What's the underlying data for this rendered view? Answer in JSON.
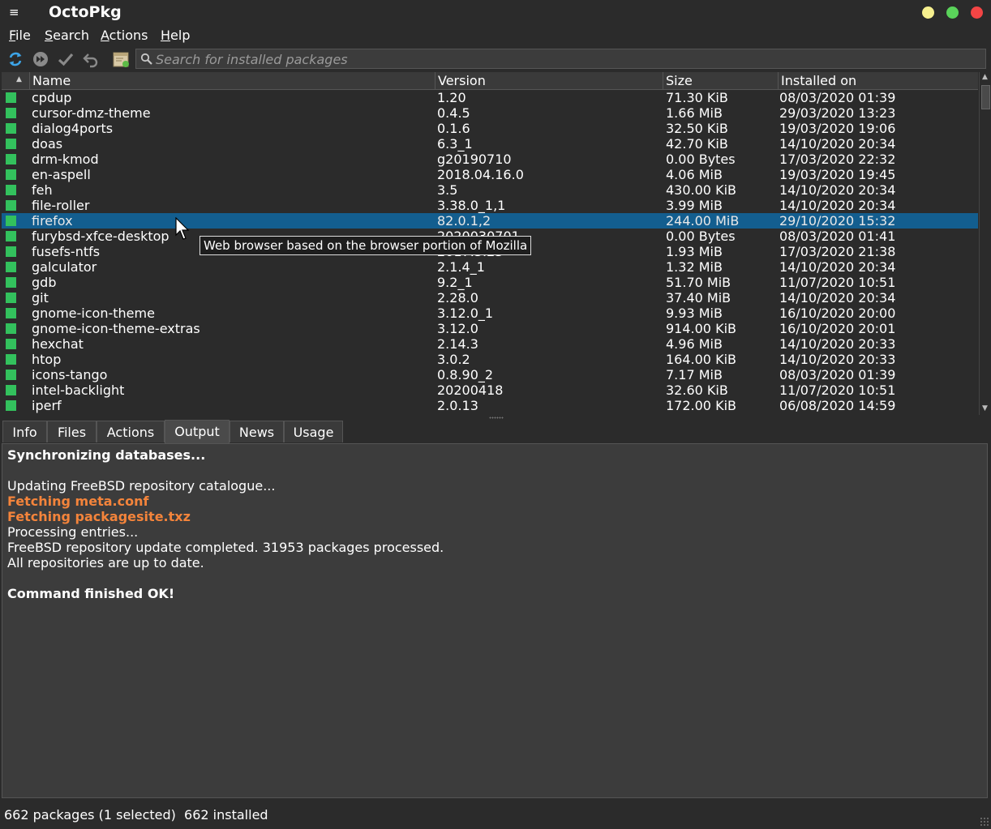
{
  "window": {
    "title": "OctoPkg",
    "menu_glyph": "≡",
    "buttons": {
      "minimize_color": "#f7f08f",
      "maximize_color": "#5ad35a",
      "close_color": "#f34545"
    }
  },
  "menubar": {
    "items": [
      {
        "first": "F",
        "rest": "ile"
      },
      {
        "first": "S",
        "rest": "earch"
      },
      {
        "first": "A",
        "rest": "ctions"
      },
      {
        "first": "H",
        "rest": "elp"
      }
    ]
  },
  "toolbar": {
    "icons": [
      "sync-database-icon",
      "run-transaction-icon",
      "commit-icon",
      "undo-icon",
      "system-upgrade-icon"
    ],
    "search_placeholder": "Search for installed packages",
    "search_value": ""
  },
  "table": {
    "columns": [
      "Name",
      "Version",
      "Size",
      "Installed on"
    ],
    "rows": [
      {
        "name": "cpdup",
        "version": "1.20",
        "size": "71.30 KiB",
        "installed": "08/03/2020 01:39"
      },
      {
        "name": "cursor-dmz-theme",
        "version": "0.4.5",
        "size": "1.66 MiB",
        "installed": "29/03/2020 13:23"
      },
      {
        "name": "dialog4ports",
        "version": "0.1.6",
        "size": "32.50 KiB",
        "installed": "19/03/2020 19:06"
      },
      {
        "name": "doas",
        "version": "6.3_1",
        "size": "42.70 KiB",
        "installed": "14/10/2020 20:34"
      },
      {
        "name": "drm-kmod",
        "version": "g20190710",
        "size": "0.00 Bytes",
        "installed": "17/03/2020 22:32"
      },
      {
        "name": "en-aspell",
        "version": "2018.04.16.0",
        "size": "4.06 MiB",
        "installed": "19/03/2020 19:45"
      },
      {
        "name": "feh",
        "version": "3.5",
        "size": "430.00 KiB",
        "installed": "14/10/2020 20:34"
      },
      {
        "name": "file-roller",
        "version": "3.38.0_1,1",
        "size": "3.99 MiB",
        "installed": "14/10/2020 20:34"
      },
      {
        "name": "firefox",
        "version": "82.0.1,2",
        "size": "244.00 MiB",
        "installed": "29/10/2020 15:32",
        "selected": true
      },
      {
        "name": "furybsd-xfce-desktop",
        "version": "2020030701",
        "size": "0.00 Bytes",
        "installed": "08/03/2020 01:41"
      },
      {
        "name": "fusefs-ntfs",
        "version": "2017.3.23",
        "size": "1.93 MiB",
        "installed": "17/03/2020 21:38"
      },
      {
        "name": "galculator",
        "version": "2.1.4_1",
        "size": "1.32 MiB",
        "installed": "14/10/2020 20:34"
      },
      {
        "name": "gdb",
        "version": "9.2_1",
        "size": "51.70 MiB",
        "installed": "11/07/2020 10:51"
      },
      {
        "name": "git",
        "version": "2.28.0",
        "size": "37.40 MiB",
        "installed": "14/10/2020 20:34"
      },
      {
        "name": "gnome-icon-theme",
        "version": "3.12.0_1",
        "size": "9.93 MiB",
        "installed": "16/10/2020 20:00"
      },
      {
        "name": "gnome-icon-theme-extras",
        "version": "3.12.0",
        "size": "914.00 KiB",
        "installed": "16/10/2020 20:01"
      },
      {
        "name": "hexchat",
        "version": "2.14.3",
        "size": "4.96 MiB",
        "installed": "14/10/2020 20:33"
      },
      {
        "name": "htop",
        "version": "3.0.2",
        "size": "164.00 KiB",
        "installed": "14/10/2020 20:33"
      },
      {
        "name": "icons-tango",
        "version": "0.8.90_2",
        "size": "7.17 MiB",
        "installed": "08/03/2020 01:39"
      },
      {
        "name": "intel-backlight",
        "version": "20200418",
        "size": "32.60 KiB",
        "installed": "11/07/2020 10:51"
      },
      {
        "name": "iperf",
        "version": "2.0.13",
        "size": "172.00 KiB",
        "installed": "06/08/2020 14:59"
      }
    ],
    "status_color": "#33c15d",
    "selection_color": "#135e8f"
  },
  "tooltip": "Web browser based on the browser portion of Mozilla",
  "tabs": [
    {
      "label": "Info"
    },
    {
      "label": "Files"
    },
    {
      "label": "Actions"
    },
    {
      "label": "Output",
      "active": true
    },
    {
      "label": "News"
    },
    {
      "label": "Usage"
    }
  ],
  "output": [
    {
      "text": "Synchronizing databases...",
      "style": "bold"
    },
    {
      "text": "",
      "style": "normal"
    },
    {
      "text": "Updating FreeBSD repository catalogue...",
      "style": "normal"
    },
    {
      "text": "Fetching meta.conf",
      "style": "orange"
    },
    {
      "text": "Fetching packagesite.txz",
      "style": "orange"
    },
    {
      "text": "Processing entries...",
      "style": "normal"
    },
    {
      "text": "FreeBSD repository update completed. 31953 packages processed.",
      "style": "normal"
    },
    {
      "text": "All repositories are up to date.",
      "style": "normal"
    },
    {
      "text": "",
      "style": "normal"
    },
    {
      "text": "Command finished OK!",
      "style": "bold"
    }
  ],
  "statusbar": {
    "text": "662 packages (1 selected)  662 installed"
  }
}
